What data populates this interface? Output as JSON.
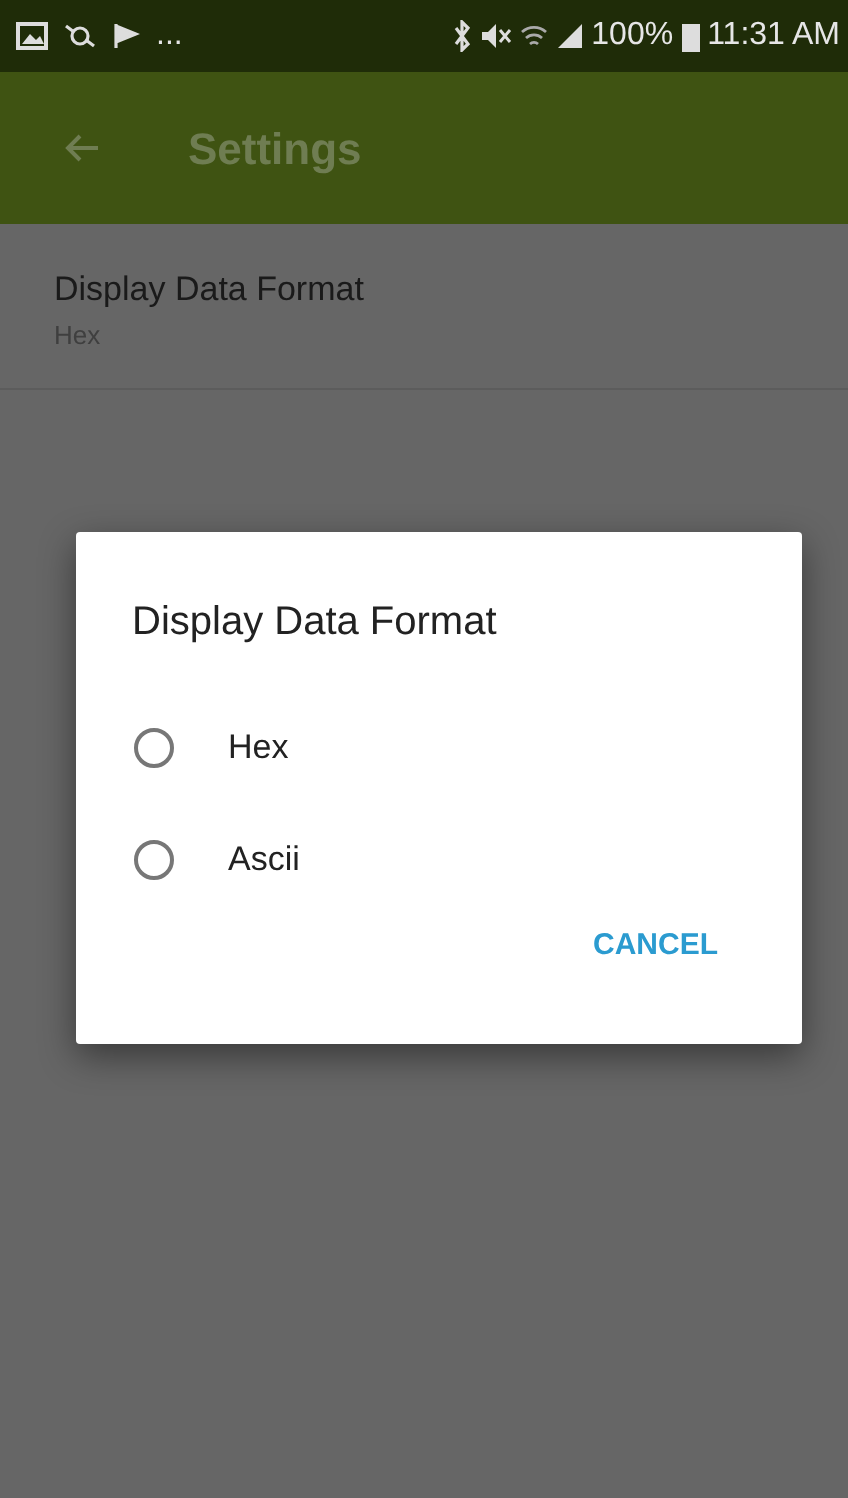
{
  "status_bar": {
    "notification_more": "...",
    "battery": "100%",
    "time": "11:31 AM"
  },
  "app_bar": {
    "title": "Settings"
  },
  "preferences": [
    {
      "title": "Display Data Format",
      "summary": "Hex"
    }
  ],
  "dialog": {
    "title": "Display Data Format",
    "options": [
      {
        "label": "Hex",
        "selected": false
      },
      {
        "label": "Ascii",
        "selected": false
      }
    ],
    "buttons": [
      "CANCEL"
    ]
  }
}
